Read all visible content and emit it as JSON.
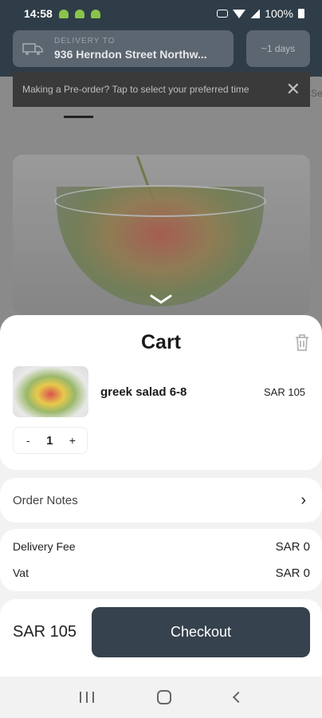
{
  "status_bar": {
    "time": "14:58",
    "battery": "100%"
  },
  "header": {
    "delivery_label": "DELIVERY TO",
    "delivery_address": "936 Herndon Street Northw...",
    "days": "~1 days"
  },
  "preorder_tip": {
    "text": "Making a Pre-order? Tap to select your preferred time"
  },
  "tab_partial": "Se",
  "cart": {
    "title": "Cart",
    "item": {
      "name": "greek salad 6-8",
      "price": "SAR 105",
      "quantity": "1"
    },
    "minus": "-",
    "plus": "+"
  },
  "notes": {
    "label": "Order Notes"
  },
  "fees": {
    "delivery_label": "Delivery Fee",
    "delivery_value": "SAR 0",
    "vat_label": "Vat",
    "vat_value": "SAR 0"
  },
  "footer": {
    "total": "SAR 105",
    "checkout_label": "Checkout"
  },
  "colors": {
    "primary": "#36424d",
    "header": "#2f3d48"
  }
}
